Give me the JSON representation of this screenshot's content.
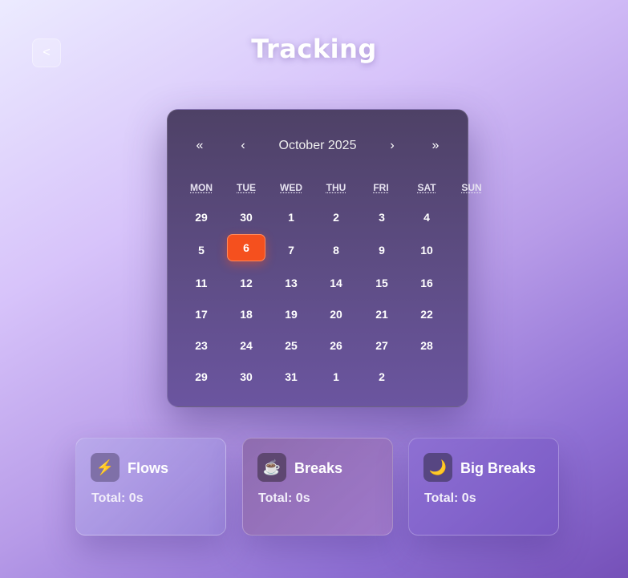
{
  "header": {
    "back_label": "<",
    "title": "Tracking"
  },
  "calendar": {
    "prev_year_label": "«",
    "prev_month_label": "‹",
    "month_label": "October 2025",
    "next_month_label": "›",
    "next_year_label": "»",
    "weekdays": [
      "MON",
      "TUE",
      "WED",
      "THU",
      "FRI",
      "SAT",
      "SUN"
    ],
    "weeks": [
      [
        "29",
        "30",
        "1",
        "2",
        "3",
        "4"
      ],
      [
        "5",
        "6",
        "7",
        "8",
        "9",
        "10"
      ],
      [
        "11",
        "12",
        "13",
        "14",
        "15",
        "16"
      ],
      [
        "17",
        "18",
        "19",
        "20",
        "21",
        "22"
      ],
      [
        "23",
        "24",
        "25",
        "26",
        "27",
        "28"
      ],
      [
        "29",
        "30",
        "31",
        "1",
        "2"
      ]
    ],
    "selected_day": "6",
    "selected_color": "#f5501e"
  },
  "cards": [
    {
      "icon": "⚡",
      "icon_name": "lightning-icon",
      "title": "Flows",
      "total": "Total: 0s"
    },
    {
      "icon": "☕",
      "icon_name": "coffee-icon",
      "title": "Breaks",
      "total": "Total: 0s"
    },
    {
      "icon": "🌙",
      "icon_name": "moon-icon",
      "title": "Big Breaks",
      "total": "Total: 0s"
    }
  ]
}
